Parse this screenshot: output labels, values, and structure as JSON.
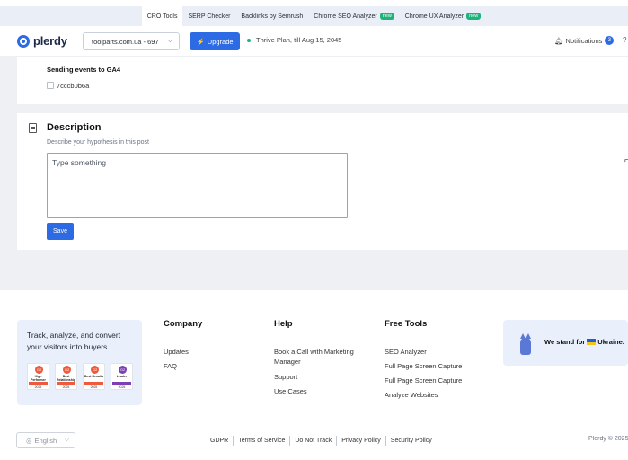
{
  "tools_bar": {
    "tabs": [
      {
        "label": "CRO Tools",
        "active": true,
        "badge": ""
      },
      {
        "label": "SERP Checker",
        "active": false,
        "badge": ""
      },
      {
        "label": "Backlinks by Semrush",
        "active": false,
        "badge": ""
      },
      {
        "label": "Chrome SEO Analyzer",
        "active": false,
        "badge": "new"
      },
      {
        "label": "Chrome UX Analyzer",
        "active": false,
        "badge": "new"
      }
    ]
  },
  "header": {
    "logo_text": "plerdy",
    "site_select": "toolparts.com.ua - 697",
    "upgrade_label": "Upgrade",
    "plan_text": "Thrive Plan, till Aug 15, 2045",
    "notifications_label": "Notifications",
    "notifications_count": "3"
  },
  "ga4": {
    "title": "Sending events to GA4",
    "code": "7cccb0b6a"
  },
  "description": {
    "title": "Description",
    "subtitle": "Describe your hypothesis in this post",
    "placeholder": "Type something",
    "save_label": "Save"
  },
  "footer": {
    "promo_text": "Track, analyze, and convert your visitors into buyers",
    "badges": [
      {
        "label": "High Performer",
        "year": "2025",
        "color": "#ef5a3c"
      },
      {
        "label": "Best Relationship",
        "year": "2025",
        "color": "#ef5a3c"
      },
      {
        "label": "Best Results",
        "year": "2025",
        "color": "#ef5a3c"
      },
      {
        "label": "Leader",
        "year": "2025",
        "color": "#7d3fb5"
      }
    ],
    "company": {
      "title": "Company",
      "links": [
        "Updates",
        "FAQ"
      ]
    },
    "help": {
      "title": "Help",
      "links": [
        "Book a Call with Marketing Manager",
        "Support",
        "Use Cases"
      ]
    },
    "free_tools": {
      "title": "Free Tools",
      "links": [
        "SEO Analyzer",
        "Full Page Screen Capture",
        "Full Page Screen Capture",
        "Analyze Websites"
      ]
    },
    "ukraine_text": "We stand for",
    "ukraine_country": "Ukraine.",
    "language": "English",
    "legal_links": [
      "GDPR",
      "Terms of Service",
      "Do Not Track",
      "Privacy Policy",
      "Security Policy"
    ],
    "copyright": "Plerdy © 2025"
  },
  "colors": {
    "accent": "#2d6be4",
    "new_badge": "#1fb37a",
    "page_bg": "#eef0f3"
  }
}
